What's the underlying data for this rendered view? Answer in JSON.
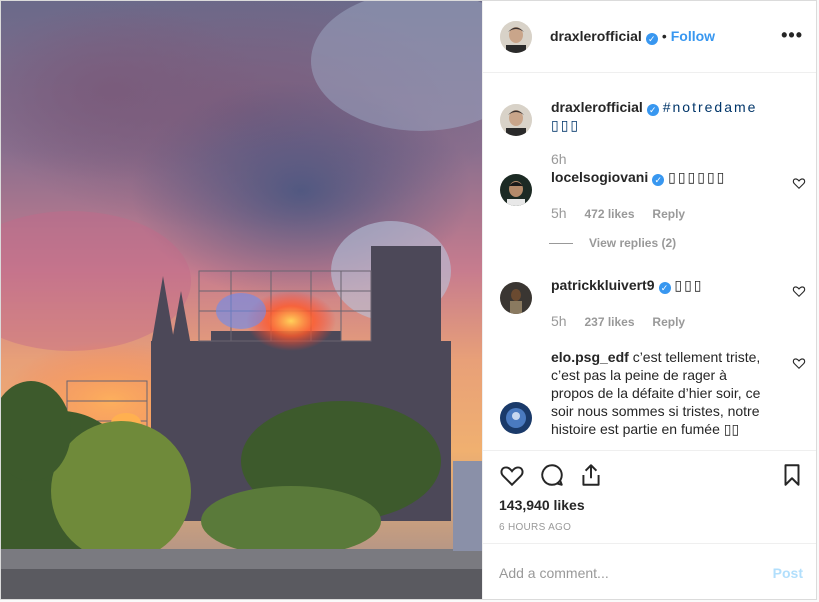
{
  "post": {
    "username": "draxlerofficial",
    "follow_label": "Follow",
    "separator": "•",
    "more_label": "•••",
    "verified_mark": "✓"
  },
  "caption": {
    "username": "draxlerofficial",
    "text": "#notredame ▯▯▯",
    "age": "6h"
  },
  "comments": [
    {
      "username": "locelsogiovani",
      "text": "▯▯▯▯▯▯",
      "age": "5h",
      "likes": "472 likes",
      "reply": "Reply",
      "view_replies": "View replies (2)"
    },
    {
      "username": "patrickkluivert9",
      "text": "▯▯▯",
      "age": "5h",
      "likes": "237 likes",
      "reply": "Reply"
    },
    {
      "username": "elo.psg_edf",
      "text": "c’est tellement triste, c’est pas la peine de rager à propos de la défaite d’hier soir, ce soir nous sommes si tristes, notre histoire est partie en fumée ▯▯"
    }
  ],
  "footer": {
    "likes_count": "143,940 likes",
    "timestamp": "6 HOURS AGO",
    "comment_placeholder": "Add a comment...",
    "post_label": "Post"
  },
  "icons": {
    "like": "heart-icon",
    "comment": "comment-icon",
    "share": "share-icon",
    "save": "bookmark-icon",
    "comment_like": "heart-icon"
  },
  "colors": {
    "accent": "#3897f0",
    "muted": "#999999",
    "border": "#efefef",
    "post_disabled": "#b2dffc"
  }
}
